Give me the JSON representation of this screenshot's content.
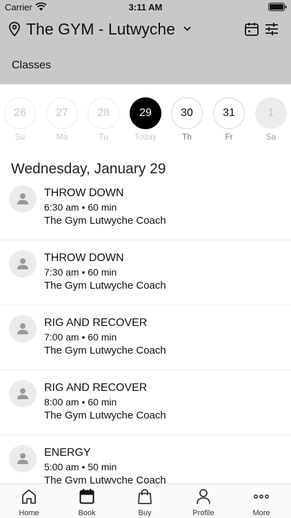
{
  "status_bar": {
    "carrier": "Carrier",
    "time": "3:11 AM"
  },
  "header": {
    "location_name": "The GYM - Lutwyche",
    "section_title": "Classes"
  },
  "days": [
    {
      "num": "26",
      "label": "Su",
      "state": "past"
    },
    {
      "num": "27",
      "label": "Mo",
      "state": "past"
    },
    {
      "num": "28",
      "label": "Tu",
      "state": "past"
    },
    {
      "num": "29",
      "label": "Today",
      "state": "today"
    },
    {
      "num": "30",
      "label": "Th",
      "state": "future"
    },
    {
      "num": "31",
      "label": "Fr",
      "state": "future"
    },
    {
      "num": "1",
      "label": "Sa",
      "state": "off"
    }
  ],
  "date_heading": "Wednesday, January 29",
  "classes": [
    {
      "title": "THROW DOWN",
      "time": "6:30 am • 60 min",
      "coach": "The Gym Lutwyche Coach"
    },
    {
      "title": "THROW DOWN",
      "time": "7:30 am • 60 min",
      "coach": "The Gym Lutwyche Coach"
    },
    {
      "title": "RIG AND RECOVER",
      "time": "7:00 am • 60 min",
      "coach": "The Gym Lutwyche Coach"
    },
    {
      "title": "RIG AND RECOVER",
      "time": "8:00 am • 60 min",
      "coach": "The Gym Lutwyche Coach"
    },
    {
      "title": "ENERGY",
      "time": "5:00 am • 50 min",
      "coach": "The Gym Lutwyche Coach"
    }
  ],
  "tabs": [
    {
      "label": "Home",
      "icon": "home-icon"
    },
    {
      "label": "Book",
      "icon": "calendar-icon",
      "active": true
    },
    {
      "label": "Buy",
      "icon": "shopping-bag-icon"
    },
    {
      "label": "Profile",
      "icon": "person-icon"
    },
    {
      "label": "More",
      "icon": "more-icon"
    }
  ]
}
